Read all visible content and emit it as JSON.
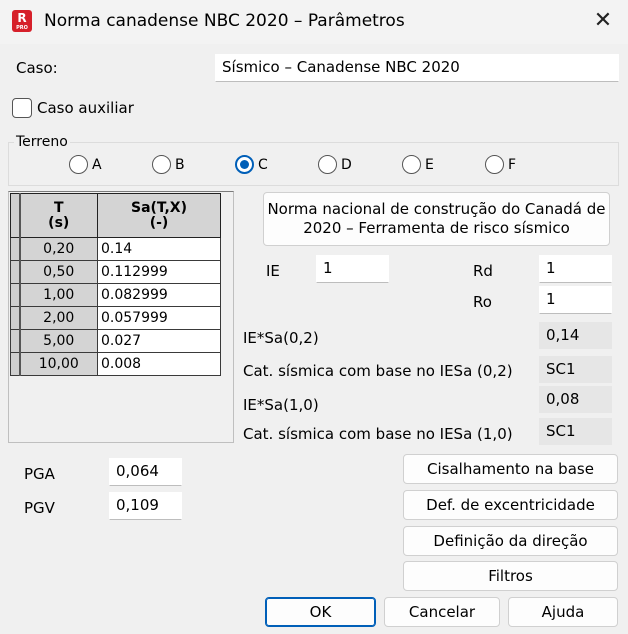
{
  "window": {
    "title": "Norma canadense NBC 2020 – Parâmetros",
    "app_badge": "R",
    "app_badge_sub": "PRO"
  },
  "caso": {
    "label": "Caso:",
    "value": "Sísmico – Canadense NBC 2020"
  },
  "caso_auxiliar": {
    "label": "Caso auxiliar",
    "checked": false
  },
  "terreno": {
    "label": "Terreno",
    "options": [
      "A",
      "B",
      "C",
      "D",
      "E",
      "F"
    ],
    "selected": "C"
  },
  "grid": {
    "headers": [
      "T\n(s)",
      "Sa(T,X)\n(-)"
    ],
    "rows": [
      {
        "t": "0,20",
        "sa": "0.14"
      },
      {
        "t": "0,50",
        "sa": "0.112999"
      },
      {
        "t": "1,00",
        "sa": "0.082999"
      },
      {
        "t": "2,00",
        "sa": "0.057999"
      },
      {
        "t": "5,00",
        "sa": "0.027"
      },
      {
        "t": "10,00",
        "sa": "0.008"
      }
    ]
  },
  "risk_tool_button": "Norma nacional de construção do Canadá de 2020 – Ferramenta de risco sísmico",
  "params": {
    "ie_label": "IE",
    "ie_value": "1",
    "rd_label": "Rd",
    "rd_value": "1",
    "ro_label": "Ro",
    "ro_value": "1"
  },
  "results": {
    "iesa02_label": "IE*Sa(0,2)",
    "iesa02_value": "0,14",
    "cat02_label": "Cat. sísmica com base no IESa (0,2)",
    "cat02_value": "SC1",
    "iesa10_label": "IE*Sa(1,0)",
    "iesa10_value": "0,08",
    "cat10_label": "Cat. sísmica com base no IESa (1,0)",
    "cat10_value": "SC1"
  },
  "pga": {
    "label": "PGA",
    "value": "0,064"
  },
  "pgv": {
    "label": "PGV",
    "value": "0,109"
  },
  "buttons": {
    "cisalhamento": "Cisalhamento na base",
    "excentricidade": "Def. de excentricidade",
    "direcao": "Definição da direção",
    "filtros": "Filtros",
    "ok": "OK",
    "cancelar": "Cancelar",
    "ajuda": "Ajuda"
  },
  "icons": {
    "close": "close-icon",
    "app": "revit-pro-icon"
  },
  "colors": {
    "accent": "#005fb8",
    "app_icon": "#d6202a"
  }
}
